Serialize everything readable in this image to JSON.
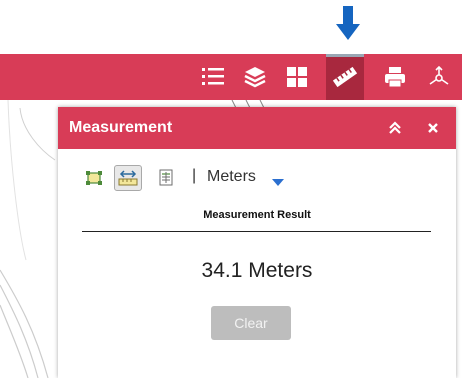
{
  "panel": {
    "title": "Measurement",
    "units": {
      "selected": "Meters"
    },
    "separator": "|",
    "result_label": "Measurement Result",
    "result_value": "34.1 Meters",
    "clear_label": "Clear"
  },
  "colors": {
    "header_red": "#d83c57",
    "active_tool": "#a8283e",
    "arrow_blue": "#1565c0"
  },
  "toolbar": {
    "icons": [
      "list-icon",
      "layers-icon",
      "grid-icon",
      "ruler-icon",
      "print-icon",
      "share-icon"
    ],
    "active": "ruler-icon"
  }
}
